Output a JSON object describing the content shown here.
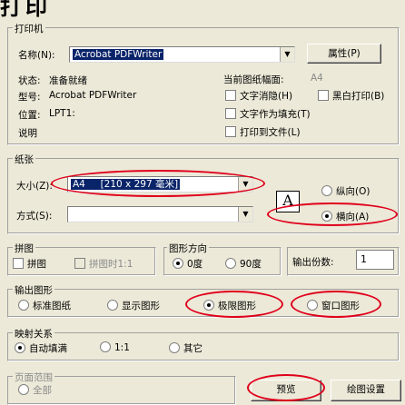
{
  "dialog": {
    "title": "打印"
  },
  "printer": {
    "group_title": "打印机",
    "name_label": "名称(N):",
    "name_value": "Acrobat PDFWriter",
    "properties_button": "属性(P)",
    "status_label": "状态:",
    "status_value": "准备就绪",
    "type_label": "型号:",
    "type_value": "Acrobat PDFWriter",
    "location_label": "位置:",
    "location_value": "LPT1:",
    "comment_label": "说明",
    "page_size_label": "当前图纸幅面:",
    "page_size_value": "A4",
    "options": [
      {
        "label": "文字消隐(H)"
      },
      {
        "label": "文字作为填充(T)"
      },
      {
        "label": "打印到文件(L)"
      }
    ],
    "bw_print": "黑白打印(B)"
  },
  "paper": {
    "group_title": "纸张",
    "size_label": "大小(Z):",
    "size_value": "A4",
    "size_dim": "[210 x 297 毫米]",
    "method_label": "方式(S):",
    "method_value": "",
    "orientation": {
      "portrait": "纵向(O)",
      "landscape": "横向(A)"
    },
    "orientation_icon_letter": "A"
  },
  "tile": {
    "group_title": "拼图",
    "tile": "拼图",
    "tile_print": "拼图时1:1"
  },
  "direction": {
    "group_title": "图形方向",
    "deg0": "0度",
    "deg90": "90度"
  },
  "copies": {
    "label": "输出份数:",
    "value": "1"
  },
  "output": {
    "group_title": "输出图形",
    "options": [
      "标准图纸",
      "显示图形",
      "极限图形",
      "窗口图形"
    ]
  },
  "mapping": {
    "group_title": "映射关系",
    "options": [
      "自动填满",
      "1:1",
      "其它"
    ]
  },
  "range": {
    "group_title": "页面范围",
    "all": "全部"
  },
  "buttons": {
    "preview": "预览",
    "draw_settings": "绘图设置"
  },
  "colors": {
    "annotation_red": "#e0001b",
    "dialog_bg": "#ECE9D8"
  }
}
